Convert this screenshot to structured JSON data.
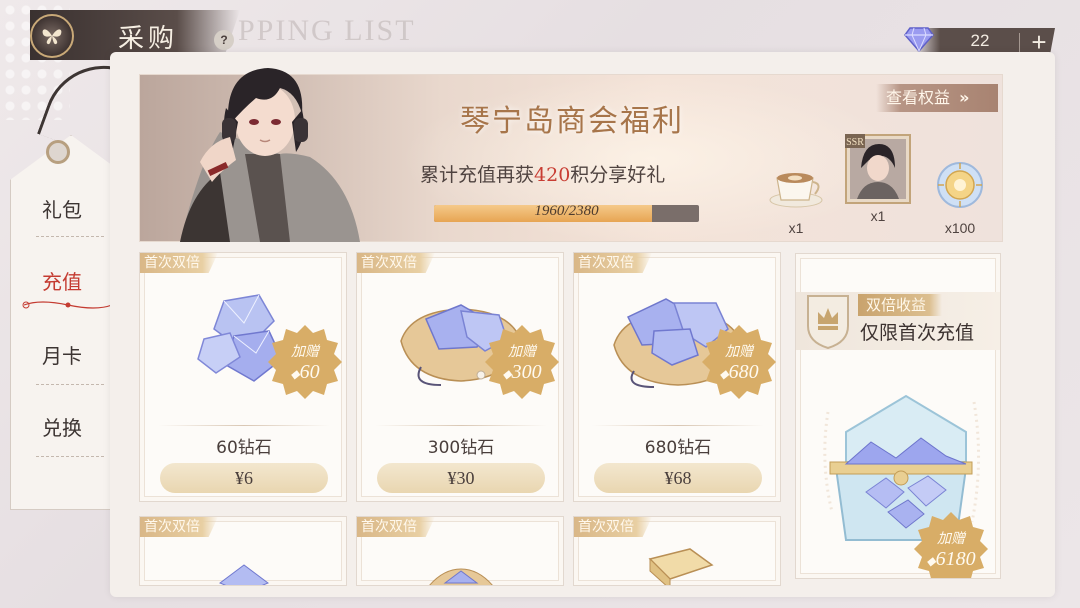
{
  "header": {
    "title": "采购",
    "help_icon": "?",
    "watermark": "PPING LIST",
    "emblem_icon": "butterfly-icon"
  },
  "currency": {
    "icon": "diamond-icon",
    "value": "22",
    "plus_label": "+"
  },
  "nav": {
    "items": [
      {
        "label": "礼包",
        "active": false
      },
      {
        "label": "充值",
        "active": true
      },
      {
        "label": "月卡",
        "active": false
      },
      {
        "label": "兑换",
        "active": false
      }
    ]
  },
  "banner": {
    "title": "琴宁岛商会福利",
    "subtitle_prefix": "累计充值再获",
    "subtitle_highlight": "420",
    "subtitle_suffix": "积分享好礼",
    "progress_text": "1960/2380",
    "progress_current": 1960,
    "progress_total": 2380,
    "benefit_button": "查看权益",
    "rewards": [
      {
        "icon": "coffee-cup-icon",
        "count": "x1"
      },
      {
        "icon": "ssr-card-icon",
        "count": "x1",
        "rarity": "SSR"
      },
      {
        "icon": "sun-token-icon",
        "count": "x100"
      }
    ]
  },
  "products": [
    {
      "badge": "首次双倍",
      "bonus_label": "加赠",
      "bonus_value": "60",
      "name": "60钻石",
      "price": "¥6"
    },
    {
      "badge": "首次双倍",
      "bonus_label": "加赠",
      "bonus_value": "300",
      "name": "300钻石",
      "price": "¥30"
    },
    {
      "badge": "首次双倍",
      "bonus_label": "加赠",
      "bonus_value": "680",
      "name": "680钻石",
      "price": "¥68"
    },
    {
      "badge": "首次双倍"
    },
    {
      "badge": "首次双倍"
    },
    {
      "badge": "首次双倍"
    }
  ],
  "promo": {
    "tag": "双倍收益",
    "title": "仅限首次充值",
    "bonus_label": "加赠",
    "bonus_value": "6180"
  },
  "colors": {
    "accent_red": "#c83d33",
    "gold": "#d9b787",
    "diamond": "#8d8ee8"
  }
}
